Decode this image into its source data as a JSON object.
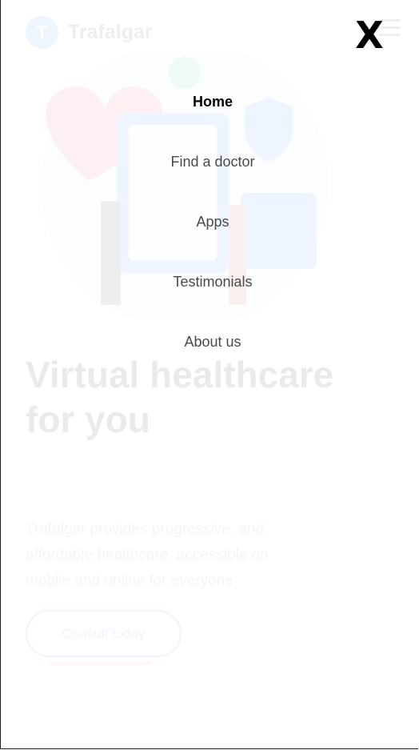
{
  "background": {
    "logo_initial": "T",
    "logo_text": "Trafalgar",
    "hero_title": "Virtual healthcare for you",
    "hero_description": "Trafalgar provides progressive, and affordable healthcare, accessible on mobile and online for everyone",
    "cta_label": "Consult today"
  },
  "menu": {
    "close_icon": "X",
    "items": [
      {
        "label": "Home",
        "active": true
      },
      {
        "label": "Find a doctor",
        "active": false
      },
      {
        "label": "Apps",
        "active": false
      },
      {
        "label": "Testimonials",
        "active": false
      },
      {
        "label": "About us",
        "active": false
      }
    ]
  },
  "colors": {
    "accent": "#458ff6",
    "heart": "#f04a66",
    "active_link": "#000000",
    "link": "#4a4a4a"
  }
}
